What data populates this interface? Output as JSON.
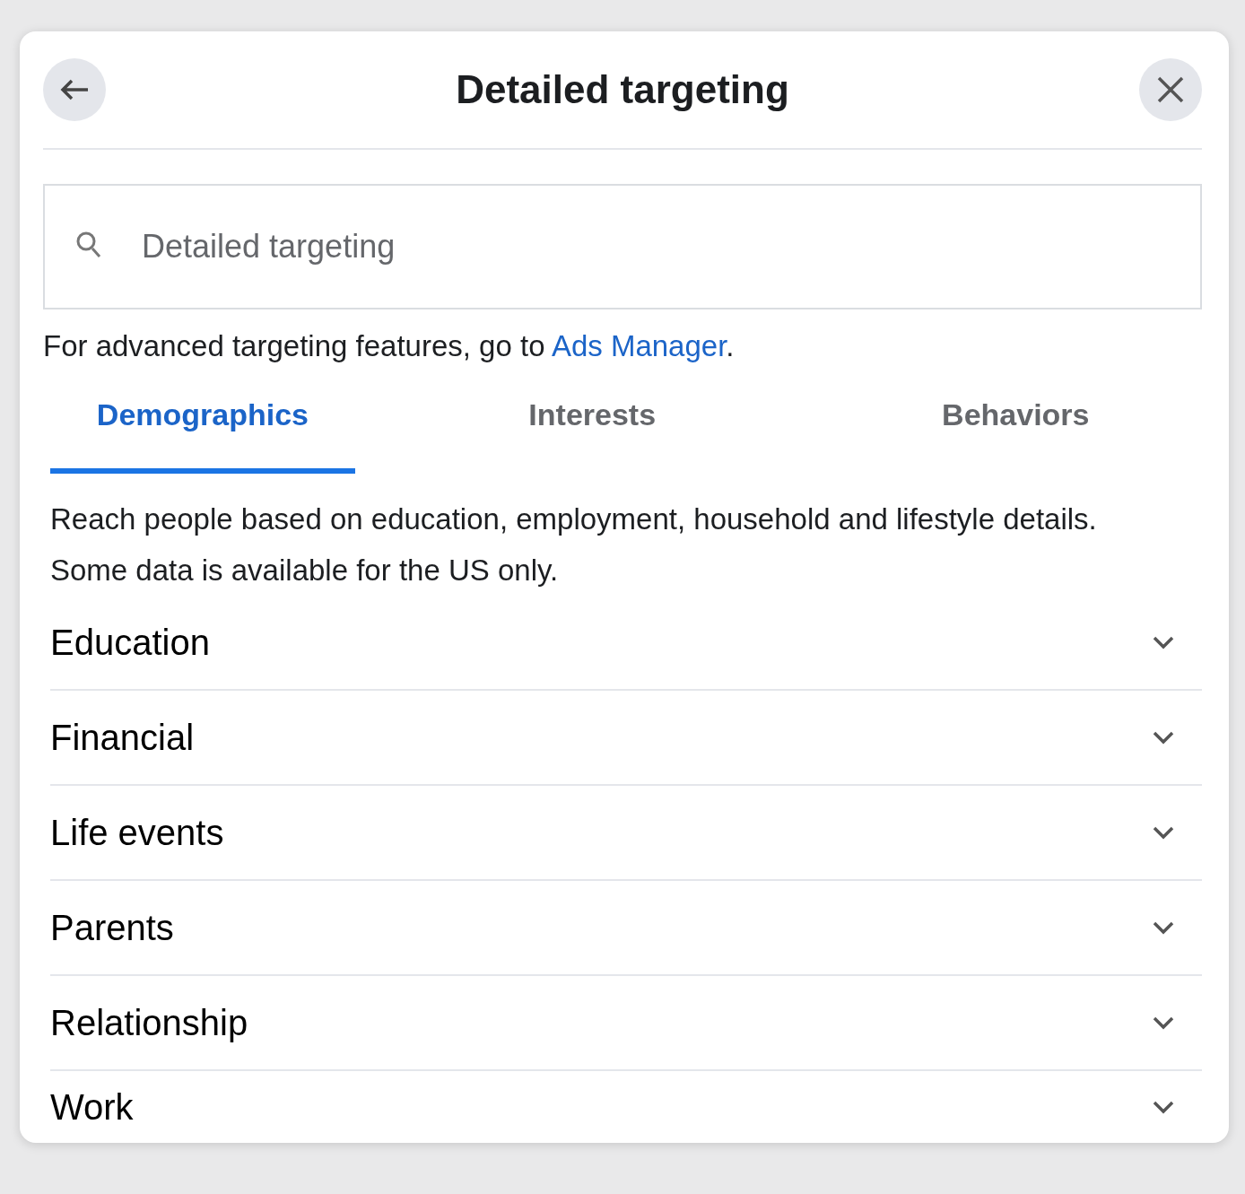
{
  "dialog": {
    "title": "Detailed targeting"
  },
  "search": {
    "placeholder": "Detailed targeting"
  },
  "notice": {
    "text": "For advanced targeting features, go to ",
    "link": "Ads Manager",
    "end": "."
  },
  "tabs": [
    {
      "label": "Demographics",
      "selected": true
    },
    {
      "label": "Interests",
      "selected": false
    },
    {
      "label": "Behaviors",
      "selected": false
    }
  ],
  "description": "Reach people based on education, employment, household and lifestyle details. Some data is available for the US only.",
  "categories": [
    {
      "label": "Education",
      "expanded": false
    },
    {
      "label": "Financial",
      "expanded": false
    },
    {
      "label": "Life events",
      "expanded": false
    },
    {
      "label": "Parents",
      "expanded": false
    },
    {
      "label": "Relationship",
      "expanded": false
    },
    {
      "label": "Work",
      "expanded": false
    }
  ]
}
